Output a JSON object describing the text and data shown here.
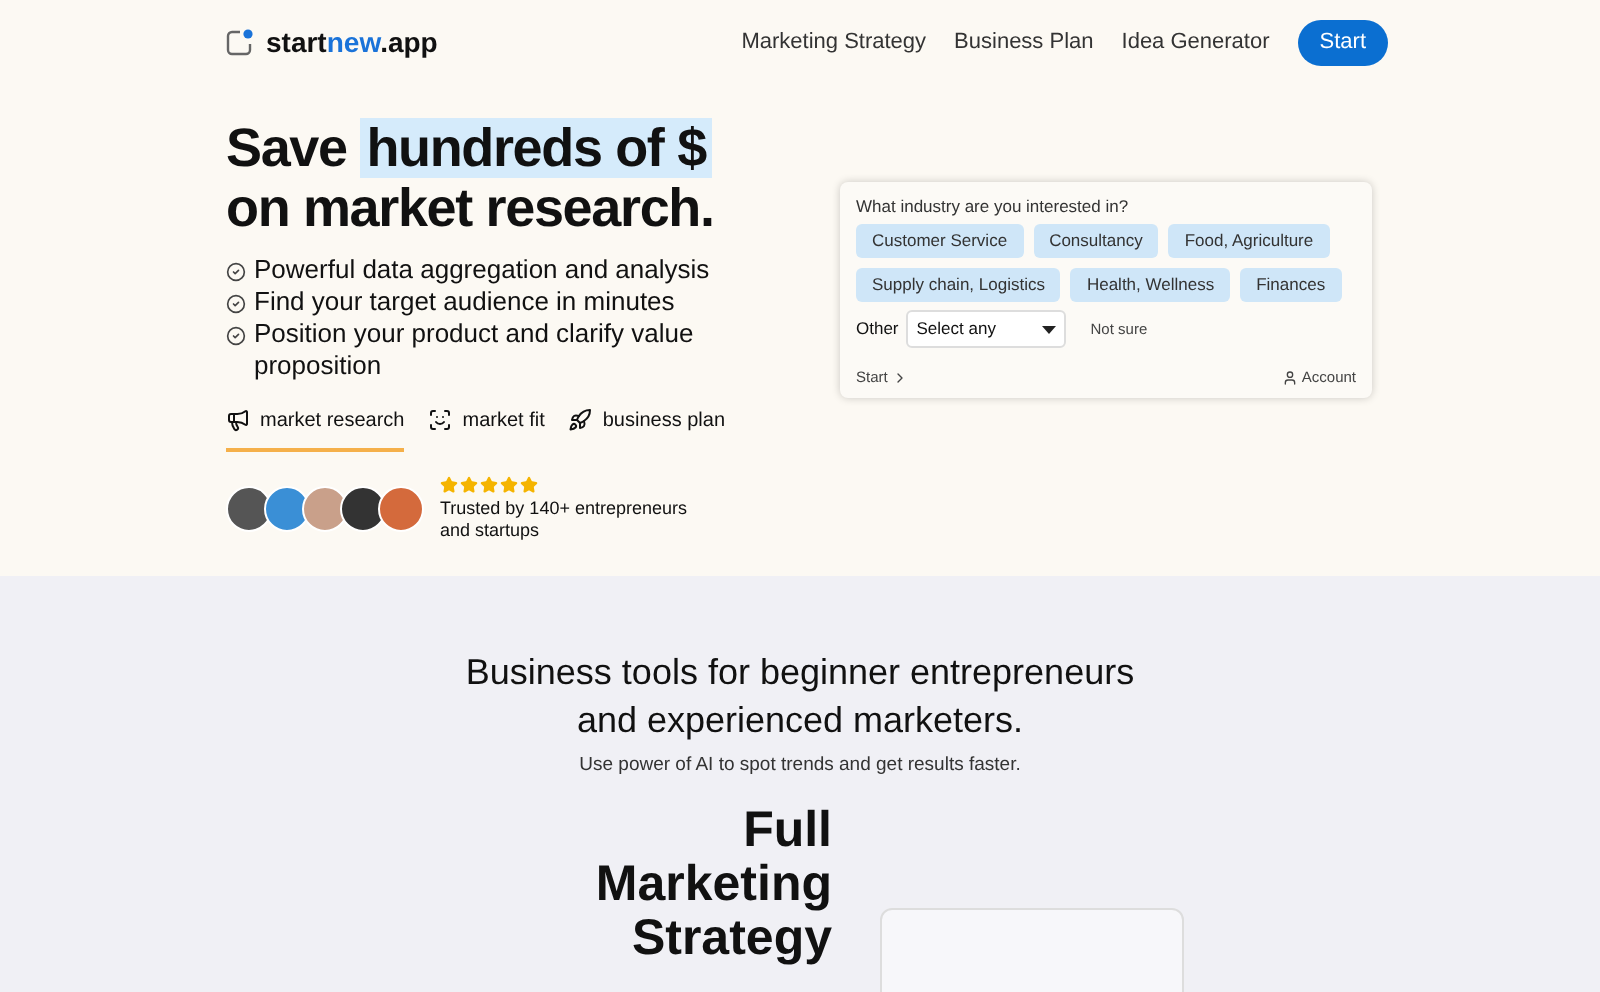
{
  "header": {
    "logo": {
      "part1": "start",
      "part2": "new",
      "part3": ".app"
    },
    "nav": [
      "Marketing Strategy",
      "Business Plan",
      "Idea Generator"
    ],
    "cta": "Start"
  },
  "hero": {
    "headline_start": "Save",
    "headline_highlight": "hundreds of $",
    "headline_end": "on market research.",
    "benefits": [
      "Powerful data aggregation and analysis",
      "Find your target audience in minutes",
      "Position your product and clarify value proposition"
    ],
    "tabs": [
      {
        "label": "market research",
        "kind": "megaphone",
        "selected": true
      },
      {
        "label": "market fit",
        "kind": "target",
        "selected": false
      },
      {
        "label": "business plan",
        "kind": "rocket",
        "selected": false
      }
    ],
    "rating": {
      "stars": 5,
      "text": "Trusted by 140+ entrepreneurs and startups"
    }
  },
  "industry_card": {
    "question": "What industry are you interested in?",
    "options": [
      "Customer Service",
      "Consultancy",
      "Food, Agriculture",
      "Supply chain, Logistics",
      "Health, Wellness",
      "Finances"
    ],
    "other_label": "Other",
    "select_value": "Select any",
    "not_sure": "Not sure",
    "start": "Start",
    "account": "Account"
  },
  "tools": {
    "title": "Business tools for beginner entrepreneurs and experienced marketers.",
    "subtitle": "Use power of AI to spot trends and get results faster.",
    "feature_title": "Full Marketing Strategy"
  }
}
